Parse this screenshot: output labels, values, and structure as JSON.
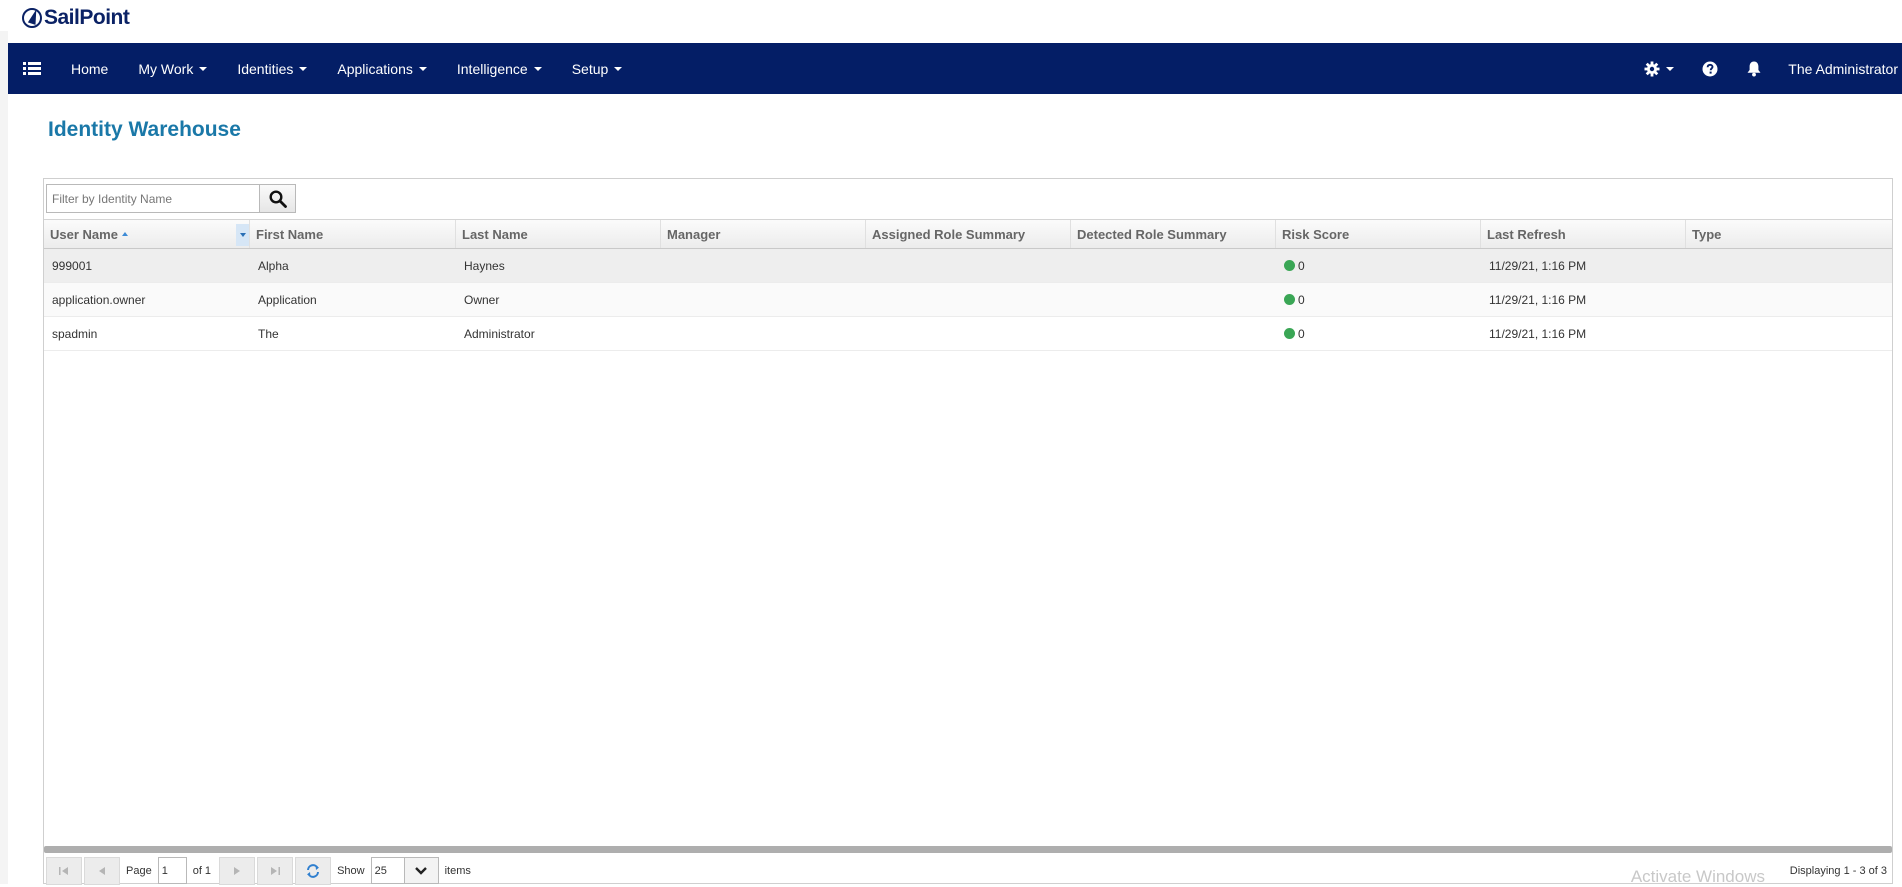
{
  "brand": {
    "logo_text": "SailPoint"
  },
  "nav": {
    "items": [
      {
        "label": "Home",
        "has_caret": false
      },
      {
        "label": "My Work",
        "has_caret": true
      },
      {
        "label": "Identities",
        "has_caret": true
      },
      {
        "label": "Applications",
        "has_caret": true
      },
      {
        "label": "Intelligence",
        "has_caret": true
      },
      {
        "label": "Setup",
        "has_caret": true
      }
    ],
    "user_name": "The Administrator",
    "icons": [
      "menu-icon",
      "gear-icon",
      "help-icon",
      "bell-icon"
    ]
  },
  "page": {
    "title": "Identity Warehouse"
  },
  "filter": {
    "placeholder": "Filter by Identity Name"
  },
  "grid": {
    "columns": [
      "User Name",
      "First Name",
      "Last Name",
      "Manager",
      "Assigned Role Summary",
      "Detected Role Summary",
      "Risk Score",
      "Last Refresh",
      "Type"
    ],
    "sorted_column": "User Name",
    "sort_direction": "ascending",
    "rows": [
      {
        "user_name": "999001",
        "first_name": "Alpha",
        "last_name": "Haynes",
        "manager": "",
        "assigned_role_summary": "",
        "detected_role_summary": "",
        "risk_score": "0",
        "last_refresh": "11/29/21, 1:16 PM",
        "type": ""
      },
      {
        "user_name": "application.owner",
        "first_name": "Application",
        "last_name": "Owner",
        "manager": "",
        "assigned_role_summary": "",
        "detected_role_summary": "",
        "risk_score": "0",
        "last_refresh": "11/29/21, 1:16 PM",
        "type": ""
      },
      {
        "user_name": "spadmin",
        "first_name": "The",
        "last_name": "Administrator",
        "manager": "",
        "assigned_role_summary": "",
        "detected_role_summary": "",
        "risk_score": "0",
        "last_refresh": "11/29/21, 1:16 PM",
        "type": ""
      }
    ],
    "risk_color": "#3aa655"
  },
  "pager": {
    "page_label": "Page",
    "page_value": "1",
    "of_label": "of 1",
    "show_label": "Show",
    "show_value": "25",
    "items_label": "items",
    "displaying": "Displaying 1 - 3 of 3"
  },
  "watermark": "Activate Windows",
  "colors": {
    "navbar": "#041e66",
    "title": "#1a78a8"
  }
}
